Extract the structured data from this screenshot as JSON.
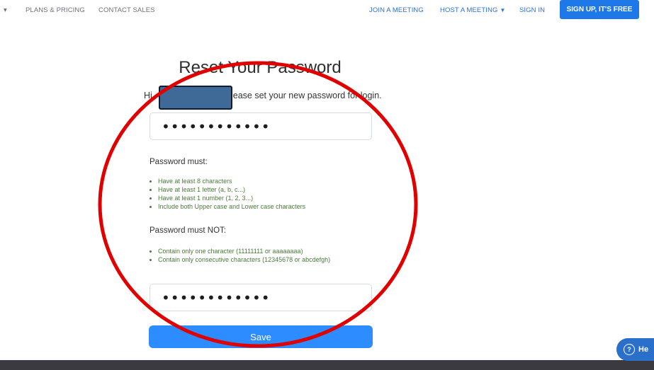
{
  "nav": {
    "left_items": [
      "PLANS & PRICING",
      "CONTACT SALES"
    ],
    "right_items": [
      "JOIN A MEETING",
      "HOST A MEETING",
      "SIGN IN"
    ],
    "signup_label": "SIGN UP, IT'S FREE",
    "accent_color": "#2d8cff"
  },
  "page": {
    "title": "Reset Your Password",
    "intro_text": "Hi",
    "intro_text_rest": "ease set your new password for login.",
    "password_value": "••••••••••••",
    "confirm_value": "••••••••••••",
    "must_title": "Password must:",
    "must_rules": [
      "Have at least 8 characters",
      "Have at least 1 letter (a, b, c...)",
      "Have at least 1 number (1, 2, 3...)",
      "Include both Upper case and Lower case characters"
    ],
    "must_not_title": "Password must NOT:",
    "must_not_rules": [
      "Contain only one character (11111111 or aaaaaaaa)",
      "Contain only consecutive characters (12345678 or abcdefgh)"
    ],
    "save_label": "Save"
  },
  "help": {
    "label": "He",
    "icon": "question-circle-icon"
  },
  "annotation": {
    "shape": "red-ellipse",
    "color": "#e00000"
  }
}
